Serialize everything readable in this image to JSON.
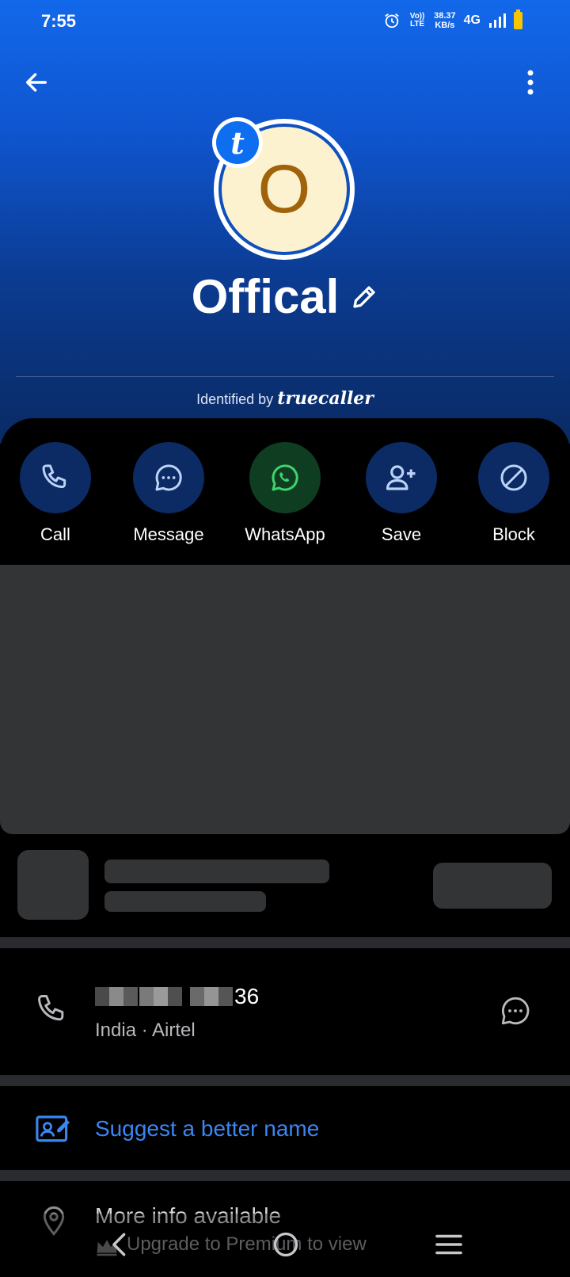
{
  "status_bar": {
    "time": "7:55",
    "volte": "Vo)) LTE",
    "speed_value": "38.37",
    "speed_unit": "KB/s",
    "network": "4G"
  },
  "header": {
    "avatar_letter": "O",
    "badge_letter": "t",
    "name": "Offical",
    "identified_by": "Identified by",
    "brand": "truecaller"
  },
  "actions": [
    {
      "label": "Call",
      "icon": "phone-icon"
    },
    {
      "label": "Message",
      "icon": "chat-bubble-icon"
    },
    {
      "label": "WhatsApp",
      "icon": "whatsapp-icon"
    },
    {
      "label": "Save",
      "icon": "add-contact-icon"
    },
    {
      "label": "Block",
      "icon": "block-icon"
    }
  ],
  "phone": {
    "number_visible_suffix": "36",
    "carrier": "India · Airtel"
  },
  "suggest": {
    "label": "Suggest a better name"
  },
  "more_info": {
    "title": "More info available",
    "subtitle": "Upgrade to Premium to view"
  },
  "colors": {
    "accent_blue": "#3a86f2",
    "avatar_bg": "#fdf2cf",
    "avatar_letter": "#a0620b",
    "battery": "#f7c500"
  }
}
